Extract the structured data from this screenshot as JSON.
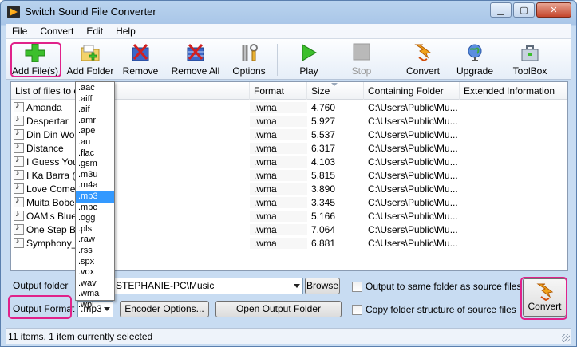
{
  "window": {
    "title": "Switch Sound File Converter",
    "controls": [
      "minimize-icon",
      "maximize-icon",
      "close-icon"
    ]
  },
  "menu": [
    "File",
    "Convert",
    "Edit",
    "Help"
  ],
  "toolbar": {
    "add_files": "Add File(s)",
    "add_folder": "Add Folder",
    "remove": "Remove",
    "remove_all": "Remove All",
    "options": "Options",
    "play": "Play",
    "stop": "Stop",
    "convert": "Convert",
    "upgrade": "Upgrade",
    "toolbox": "ToolBox"
  },
  "list": {
    "columns": [
      "List of files to co",
      "Format",
      "Size",
      "Containing Folder",
      "Extended Information"
    ],
    "rows": [
      {
        "name": "Amanda",
        "format": ".wma",
        "size": "4.760",
        "folder": "C:\\Users\\Public\\Mu..."
      },
      {
        "name": "Despertar",
        "format": ".wma",
        "size": "5.927",
        "folder": "C:\\Users\\Public\\Mu..."
      },
      {
        "name": "Din Din Wo (",
        "format": ".wma",
        "size": "5.537",
        "folder": "C:\\Users\\Public\\Mu..."
      },
      {
        "name": "Distance",
        "format": ".wma",
        "size": "6.317",
        "folder": "C:\\Users\\Public\\Mu..."
      },
      {
        "name": "I Guess You'",
        "format": ".wma",
        "size": "4.103",
        "folder": "C:\\Users\\Public\\Mu..."
      },
      {
        "name": "I Ka Barra (Y",
        "format": ".wma",
        "size": "5.815",
        "folder": "C:\\Users\\Public\\Mu..."
      },
      {
        "name": "Love Comes",
        "format": ".wma",
        "size": "3.890",
        "folder": "C:\\Users\\Public\\Mu..."
      },
      {
        "name": "Muita Bobeir",
        "format": ".wma",
        "size": "3.345",
        "folder": "C:\\Users\\Public\\Mu..."
      },
      {
        "name": "OAM's Blues",
        "format": ".wma",
        "size": "5.166",
        "folder": "C:\\Users\\Public\\Mu..."
      },
      {
        "name": "One Step Be",
        "format": ".wma",
        "size": "7.064",
        "folder": "C:\\Users\\Public\\Mu..."
      },
      {
        "name": "Symphony_N",
        "format": ".wma",
        "size": "6.881",
        "folder": "C:\\Users\\Public\\Mu..."
      }
    ]
  },
  "format_dropdown": {
    "options": [
      ".aac",
      ".aiff",
      ".aif",
      ".amr",
      ".ape",
      ".au",
      ".flac",
      ".gsm",
      ".m3u",
      ".m4a",
      ".mp3",
      ".mpc",
      ".ogg",
      ".pls",
      ".raw",
      ".rss",
      ".spx",
      ".vox",
      ".wav",
      ".wma",
      ".wpl"
    ],
    "selected": ".mp3"
  },
  "bottom": {
    "output_folder_label": "Output folder",
    "output_folder_value": "STEPHANIE-PC\\Music",
    "browse": "Browse",
    "output_format_label": "Output Format",
    "output_format_value": ".mp3",
    "encoder_options": "Encoder Options...",
    "open_output_folder": "Open Output Folder",
    "same_folder": "Output to same folder as source files",
    "copy_structure": "Copy folder structure of source files",
    "convert": "Convert"
  },
  "status": "11 items, 1 item currently selected",
  "colors": {
    "highlight": "#e0228a",
    "selection": "#3399ff"
  }
}
